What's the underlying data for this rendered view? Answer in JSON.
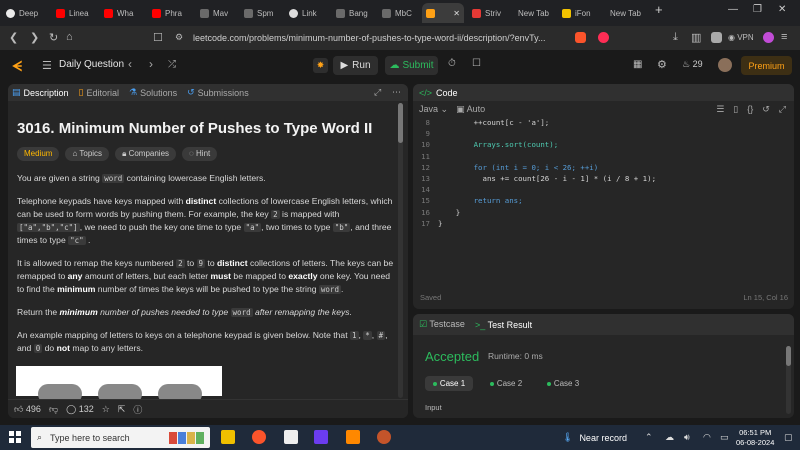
{
  "browser": {
    "tabs": [
      {
        "label": "Deep",
        "color": "#eaeaea"
      },
      {
        "label": "Linea",
        "color": "#ff0000"
      },
      {
        "label": "Wha",
        "color": "#ff0000"
      },
      {
        "label": "Phra",
        "color": "#ff0000"
      },
      {
        "label": "Mav",
        "color": "#6a6a6a"
      },
      {
        "label": "Spm",
        "color": "#6a6a6a"
      },
      {
        "label": "Link",
        "color": "#dcdcdc"
      },
      {
        "label": "Bang",
        "color": "#6a6a6a"
      },
      {
        "label": "MbC",
        "color": "#6a6a6a"
      },
      {
        "label": "",
        "color": "#ffa116"
      },
      {
        "label": "Striv",
        "color": "#e53935"
      },
      {
        "label": "New Tab",
        "color": ""
      },
      {
        "label": "iFon",
        "color": "#f2c200"
      },
      {
        "label": "New Tab",
        "color": ""
      }
    ],
    "url": "leetcode.com/problems/minimum-number-of-pushes-to-type-word-ii/description/?envTy...",
    "vpn_label": "VPN"
  },
  "nav": {
    "daily_label": "Daily Question",
    "run_label": "Run",
    "submit_label": "Submit",
    "streak": "29",
    "premium_label": "Premium"
  },
  "left_tabs": [
    "Description",
    "Editorial",
    "Solutions",
    "Submissions"
  ],
  "problem": {
    "title": "3016. Minimum Number of Pushes to Type Word II",
    "difficulty": "Medium",
    "tags": [
      "Topics",
      "Companies",
      "Hint"
    ],
    "p1_a": "You are given a string ",
    "p1_code": "word",
    "p1_b": " containing lowercase English letters.",
    "p2_a": "Telephone keypads have keys mapped with ",
    "p2_b1": "distinct",
    "p2_c": " collections of lowercase English letters, which can be used to form words by pushing them. For example, the key ",
    "p2_code1": "2",
    "p2_d": " is mapped with ",
    "p2_code2": "[\"a\",\"b\",\"c\"]",
    "p2_e": ", we need to push the key one time to type ",
    "p2_code3": "\"a\"",
    "p2_f": ", two times to type ",
    "p2_code4": "\"b\"",
    "p2_g": ", and three times to type ",
    "p2_code5": "\"c\"",
    "p2_h": " .",
    "p3_a": "It is allowed to remap the keys numbered ",
    "p3_code1": "2",
    "p3_b": " to ",
    "p3_code2": "9",
    "p3_c": " to ",
    "p3_b1": "distinct",
    "p3_d": " collections of letters. The keys can be remapped to ",
    "p3_b2": "any",
    "p3_e": " amount of letters, but each letter ",
    "p3_b3": "must",
    "p3_f": " be mapped to ",
    "p3_b4": "exactly",
    "p3_g": " one key. You need to find the ",
    "p3_b5": "minimum",
    "p3_h": " number of times the keys will be pushed to type the string ",
    "p3_code3": "word",
    "p3_i": ".",
    "p4_a": "Return the ",
    "p4_b": "minimum",
    "p4_c": " number of pushes needed to type ",
    "p4_code": "word",
    "p4_d": " after remapping the keys.",
    "p5_a": "An example mapping of letters to keys on a telephone keypad is given below. Note that ",
    "p5_code1": "1",
    "p5_b": ", ",
    "p5_code2": "*",
    "p5_c": ", ",
    "p5_code3": "#",
    "p5_d": ", and ",
    "p5_code4": "0",
    "p5_e": " do ",
    "p5_b1": "not",
    "p5_f": " map to any letters."
  },
  "footer": {
    "likes": "496",
    "comments": "132"
  },
  "code": {
    "header": "Code",
    "language": "Java",
    "mode": "Auto",
    "lines": [
      {
        "n": "8",
        "t": "        ++count[c - 'a'];"
      },
      {
        "n": "9",
        "t": ""
      },
      {
        "n": "10",
        "t": "        Arrays.sort(count);"
      },
      {
        "n": "11",
        "t": ""
      },
      {
        "n": "12",
        "t": "        for (int i = 0; i < 26; ++i)"
      },
      {
        "n": "13",
        "t": "          ans += count[26 - i - 1] * (i / 8 + 1);"
      },
      {
        "n": "14",
        "t": ""
      },
      {
        "n": "15",
        "t": "        return ans;"
      },
      {
        "n": "16",
        "t": "    }"
      },
      {
        "n": "17",
        "t": "}"
      }
    ],
    "saved": "Saved",
    "position": "Ln 15, Col 16"
  },
  "test": {
    "tab1": "Testcase",
    "tab2": "Test Result",
    "status": "Accepted",
    "runtime": "Runtime: 0 ms",
    "cases": [
      "Case 1",
      "Case 2",
      "Case 3"
    ],
    "input_label": "Input"
  },
  "taskbar": {
    "search_placeholder": "Type here to search",
    "weather": "Near record",
    "time": "06:51 PM",
    "date": "06-08-2024"
  }
}
